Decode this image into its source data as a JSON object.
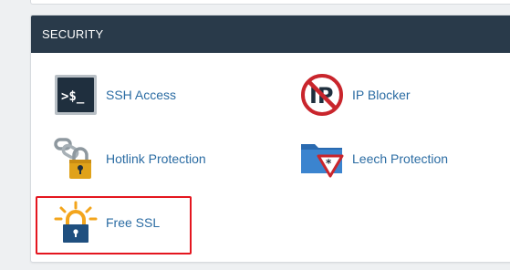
{
  "section": {
    "title": "SECURITY"
  },
  "items": [
    {
      "label": "SSH Access",
      "icon": "terminal-icon"
    },
    {
      "label": "IP Blocker",
      "icon": "ip-blocked-icon"
    },
    {
      "label": "Hotlink Protection",
      "icon": "chain-lock-icon"
    },
    {
      "label": "Leech Protection",
      "icon": "folder-warning-icon"
    },
    {
      "label": "Free SSL",
      "icon": "lock-sun-icon"
    }
  ],
  "highlight": {
    "target": "Free SSL",
    "color": "#e4161f"
  },
  "colors": {
    "header_bg": "#293a4a",
    "link": "#2b6ca3"
  }
}
